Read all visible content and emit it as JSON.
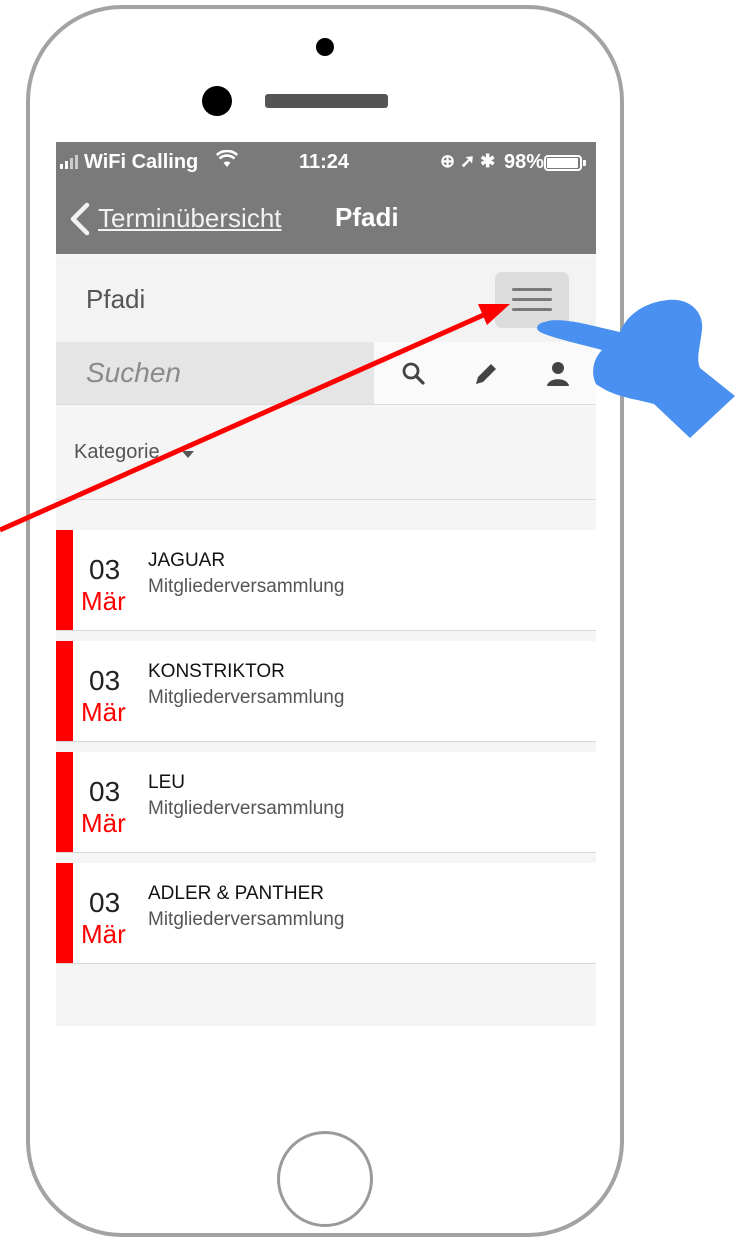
{
  "status_bar": {
    "carrier": "WiFi Calling",
    "wifi_icon": "wifi-icon",
    "time": "11:24",
    "icons": "⊕ ➚ ✱",
    "battery": "98%"
  },
  "nav": {
    "back_label": "Terminübersicht",
    "title": "Pfadi"
  },
  "header": {
    "title": "Pfadi",
    "menu_icon": "hamburger-menu-icon"
  },
  "search": {
    "placeholder": "Suchen",
    "icons": [
      "search-icon",
      "pencil-icon",
      "user-icon"
    ]
  },
  "filter": {
    "label": "Kategorie"
  },
  "events": [
    {
      "day": "03",
      "month": "Mär",
      "name": "JAGUAR",
      "type": "Mitgliederversammlung"
    },
    {
      "day": "03",
      "month": "Mär",
      "name": "KONSTRIKTOR",
      "type": "Mitgliederversammlung"
    },
    {
      "day": "03",
      "month": "Mär",
      "name": "LEU",
      "type": "Mitgliederversammlung"
    },
    {
      "day": "03",
      "month": "Mär",
      "name": "ADLER & PANTHER",
      "type": "Mitgliederversammlung"
    }
  ],
  "colors": {
    "accent": "#ff0000",
    "nav_bg": "#7a7a7a",
    "hand": "#4a90f0"
  },
  "annotations": {
    "arrow": "red-arrow-pointer",
    "hand": "pointing-hand-icon"
  }
}
